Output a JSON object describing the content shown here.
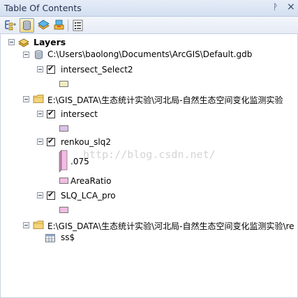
{
  "window": {
    "title": "Table Of Contents",
    "pin_glyph": "ᚹ",
    "close_glyph": "×"
  },
  "toolbar": {
    "buttons": [
      {
        "name": "list-by-drawing-order",
        "icon": "layers-drawing-order-icon"
      },
      {
        "name": "list-by-source",
        "icon": "database-source-icon",
        "active": true
      },
      {
        "name": "list-by-visibility",
        "icon": "visibility-icon"
      },
      {
        "name": "list-by-selection",
        "icon": "selection-icon"
      },
      {
        "name": "options",
        "icon": "options-icon"
      }
    ]
  },
  "tree": {
    "root_label": "Layers",
    "groups": [
      {
        "source": "C:\\Users\\baolong\\Documents\\ArcGIS\\Default.gdb",
        "layers": [
          {
            "name": "intersect_Select2",
            "checked": true,
            "swatch_color": "#f0ecc4"
          }
        ]
      },
      {
        "source": "E:\\GIS_DATA\\生态统计实验\\河北局-自然生态空间变化监测实验",
        "layers": [
          {
            "name": "intersect",
            "checked": true,
            "swatch_color": "#d9c2e8"
          },
          {
            "name": "renkou_slq2",
            "checked": true,
            "ramp_value": ".075",
            "ramp_color": "#f3bce3",
            "field": "AreaRatio",
            "swatch_color": "#f3bce3"
          },
          {
            "name": "SLQ_LCA_pro",
            "checked": true,
            "swatch_color": "#f3bce3"
          }
        ]
      },
      {
        "source": "E:\\GIS_DATA\\生态统计实验\\河北局-自然生态空间变化监测实验\\re",
        "tables": [
          {
            "name": "ss$"
          }
        ]
      }
    ]
  },
  "watermark": "http://blog.csdn.net/"
}
